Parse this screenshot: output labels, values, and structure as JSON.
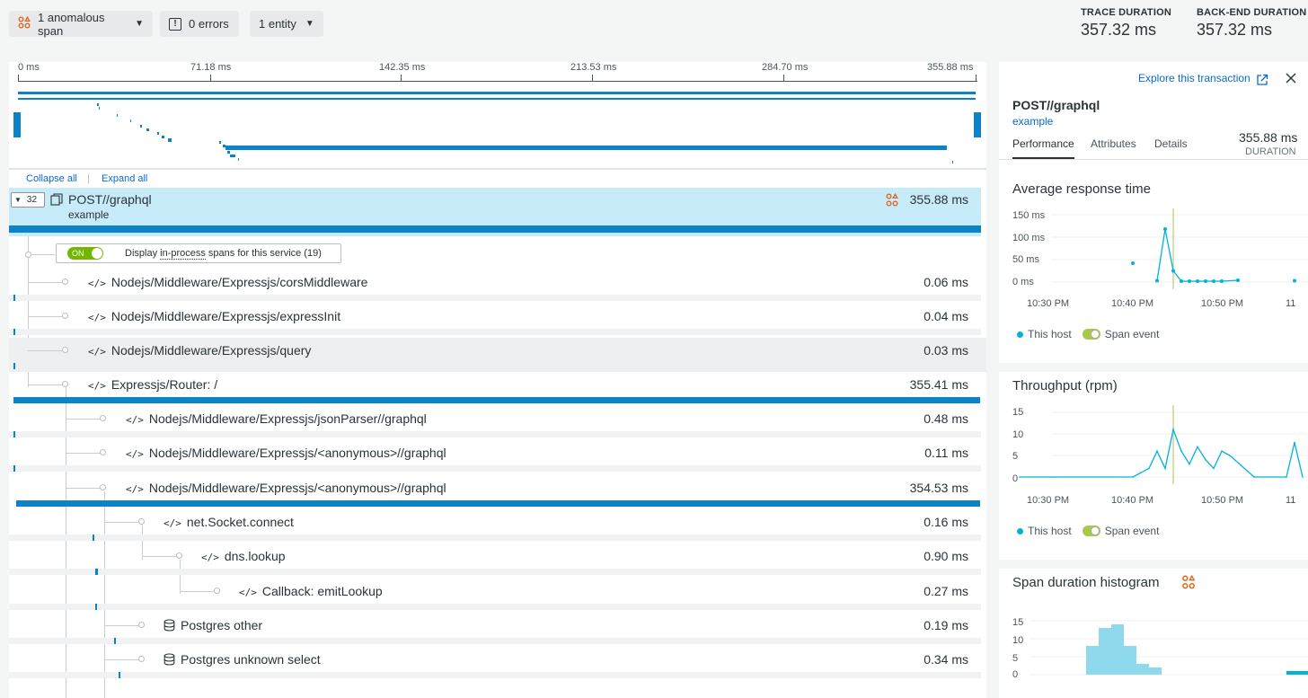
{
  "topbar": {
    "anomalous_label": "1 anomalous span",
    "errors_label": "0 errors",
    "entity_label": "1 entity",
    "trace_duration_label": "TRACE DURATION",
    "trace_duration_value": "357.32 ms",
    "backend_duration_label": "BACK-END DURATION",
    "backend_duration_value": "357.32 ms"
  },
  "ruler": {
    "ticks": [
      "0 ms",
      "71.18 ms",
      "142.35 ms",
      "213.53 ms",
      "284.70 ms",
      "355.88 ms"
    ]
  },
  "links": {
    "collapse_all": "Collapse all",
    "expand_all": "Expand all"
  },
  "root_span": {
    "count": "32",
    "name": "POST//graphql",
    "service": "example",
    "duration": "355.88 ms"
  },
  "toggle": {
    "state": "ON",
    "label_prefix": "Display ",
    "label_link": "in-process",
    "label_suffix": " spans for this service (19)"
  },
  "spans": [
    {
      "name": "Nodejs/Middleware/Expressjs/corsMiddleware",
      "duration": "0.06 ms",
      "icon": "code-icon"
    },
    {
      "name": "Nodejs/Middleware/Expressjs/expressInit",
      "duration": "0.04 ms",
      "icon": "code-icon"
    },
    {
      "name": "Nodejs/Middleware/Expressjs/query",
      "duration": "0.03 ms",
      "icon": "code-icon"
    },
    {
      "name": "Expressjs/Router: /",
      "duration": "355.41 ms",
      "icon": "code-icon"
    },
    {
      "name": "Nodejs/Middleware/Expressjs/jsonParser//graphql",
      "duration": "0.48 ms",
      "icon": "code-icon"
    },
    {
      "name": "Nodejs/Middleware/Expressjs/<anonymous>//graphql",
      "duration": "0.11 ms",
      "icon": "code-icon"
    },
    {
      "name": "Nodejs/Middleware/Expressjs/<anonymous>//graphql",
      "duration": "354.53 ms",
      "icon": "code-icon"
    },
    {
      "name": "net.Socket.connect",
      "duration": "0.16 ms",
      "icon": "code-icon"
    },
    {
      "name": "dns.lookup",
      "duration": "0.90 ms",
      "icon": "code-icon"
    },
    {
      "name": "Callback: emitLookup",
      "duration": "0.27 ms",
      "icon": "code-icon"
    },
    {
      "name": "Postgres other",
      "duration": "0.19 ms",
      "icon": "database-icon"
    },
    {
      "name": "Postgres unknown select",
      "duration": "0.34 ms",
      "icon": "database-icon"
    }
  ],
  "side": {
    "explore_link": "Explore this transaction",
    "title": "POST//graphql",
    "subtitle": "example",
    "tabs": [
      "Performance",
      "Attributes",
      "Details"
    ],
    "duration_value": "355.88 ms",
    "duration_label": "DURATION",
    "sections": {
      "avg_response": "Average response time",
      "throughput": "Throughput (rpm)",
      "histogram": "Span duration histogram"
    },
    "legend_host": "This host",
    "legend_span": "Span event"
  },
  "chart_data": [
    {
      "type": "scatter",
      "title": "Average response time",
      "y_ticks": [
        "150 ms",
        "100 ms",
        "50 ms",
        "0 ms"
      ],
      "x_ticks": [
        "10:30 PM",
        "10:40 PM",
        "10:50 PM",
        "11"
      ],
      "ylim": [
        0,
        150
      ],
      "x": [
        "10:40",
        "10:43",
        "10:44",
        "10:45",
        "10:46",
        "10:47",
        "10:48",
        "10:49",
        "10:50",
        "10:51",
        "10:53",
        "11:00"
      ],
      "values": [
        42,
        3,
        118,
        25,
        2,
        2,
        2,
        2,
        2,
        2,
        4,
        3
      ],
      "series": [
        {
          "name": "This host",
          "color": "#00b3d7"
        },
        {
          "name": "Span event",
          "color": "#a8c84a"
        }
      ],
      "marker_time": "10:45"
    },
    {
      "type": "line",
      "title": "Throughput (rpm)",
      "y_ticks": [
        "15",
        "10",
        "5",
        "0"
      ],
      "x_ticks": [
        "10:30 PM",
        "10:40 PM",
        "10:50 PM",
        "11"
      ],
      "ylim": [
        0,
        15
      ],
      "x": [
        "10:26",
        "10:30",
        "10:35",
        "10:40",
        "10:42",
        "10:43",
        "10:44",
        "10:45",
        "10:46",
        "10:47",
        "10:48",
        "10:49",
        "10:50",
        "10:51",
        "10:52",
        "10:55",
        "10:59",
        "11:00",
        "11:01"
      ],
      "values": [
        0,
        0,
        0,
        0,
        2,
        6,
        2,
        11,
        6,
        3,
        7,
        4,
        2,
        6,
        5,
        0,
        0,
        8,
        0
      ],
      "series": [
        {
          "name": "This host",
          "color": "#00b3d7"
        },
        {
          "name": "Span event",
          "color": "#a8c84a"
        }
      ],
      "marker_time": "10:45"
    },
    {
      "type": "bar",
      "title": "Span duration histogram",
      "y_ticks": [
        "15",
        "10",
        "5",
        "0"
      ],
      "ylim": [
        0,
        15
      ],
      "values": [
        8,
        13,
        14,
        8,
        3,
        2
      ],
      "extra_bar": {
        "value": 1
      }
    }
  ]
}
